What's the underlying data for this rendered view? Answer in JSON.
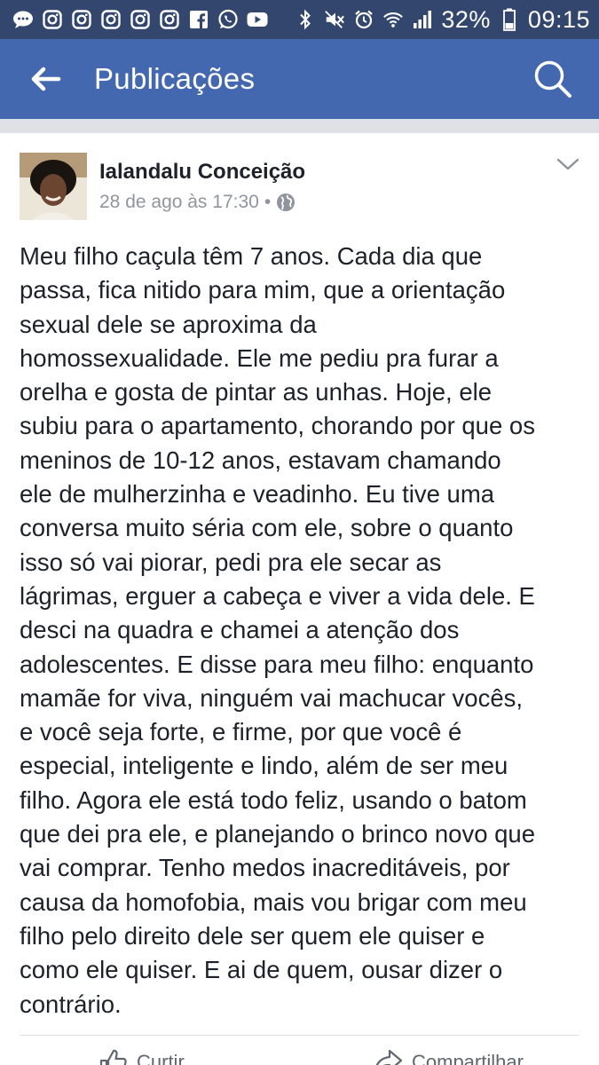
{
  "status_bar": {
    "battery_percent": "32%",
    "time": "09:15",
    "notification_icons": [
      "chat-icon",
      "instagram-icon",
      "instagram-icon",
      "instagram-icon",
      "instagram-icon",
      "instagram-icon",
      "facebook-icon",
      "whatsapp-icon",
      "youtube-icon"
    ],
    "system_icons": [
      "bluetooth-icon",
      "mute-icon",
      "alarm-icon",
      "wifi-icon",
      "signal-icon",
      "battery-icon"
    ]
  },
  "app_bar": {
    "title": "Publicações",
    "color": "#4468b0"
  },
  "post": {
    "author": "Ialandalu Conceição",
    "timestamp": "28 de ago às 17:30",
    "separator": "•",
    "privacy": "public-globe-icon",
    "text": "Meu filho caçula têm 7 anos. Cada dia que\npassa, fica nitido para mim, que a orientação\nsexual dele se aproxima da\nhomossexualidade. Ele me pediu pra furar a\norelha e gosta de pintar as unhas. Hoje, ele\nsubiu para o apartamento, chorando por que os\nmeninos de 10-12 anos, estavam chamando\nele de mulherzinha e veadinho. Eu tive uma\nconversa muito séria com ele, sobre o quanto\nisso só vai piorar, pedi pra ele secar as\nlágrimas, erguer a cabeça e viver a vida dele. E\ndesci na quadra e chamei a atenção dos\nadolescentes. E disse para meu filho: enquanto\nmamãe for viva, ninguém vai machucar vocês,\ne você seja forte, e firme, por que você é\nespecial, inteligente e lindo, além de ser meu\nfilho. Agora ele está todo feliz, usando o batom\nque dei pra ele, e planejando o brinco novo que\nvai comprar. Tenho medos inacreditáveis, por\ncausa da homofobia, mais vou brigar com meu\nfilho pelo direito dele ser quem ele quiser e\ncomo ele quiser. E ai de quem, ousar dizer o\ncontrário."
  },
  "actions": {
    "like": "Curtir",
    "share": "Compartilhar"
  }
}
